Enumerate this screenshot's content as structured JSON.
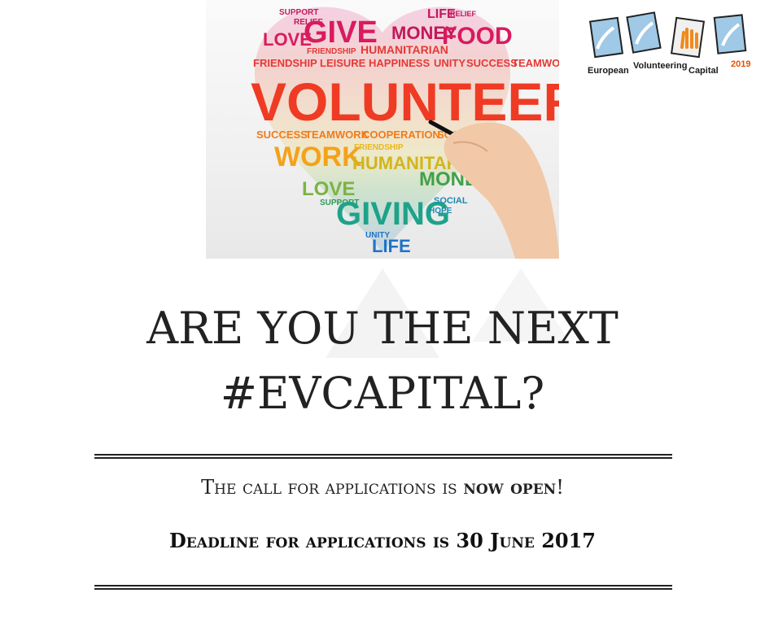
{
  "photo": {
    "words": [
      "SUPPORT",
      "RELIEF",
      "LIFE",
      "RELIEF",
      "LOVE",
      "GIVE",
      "MONEY",
      "FOOD",
      "FRIENDSHIP",
      "HUMANITARIAN",
      "FRIENDSHIP",
      "LEISURE",
      "HAPPINESS",
      "UNITY",
      "SUCCESS",
      "TEAMWORK",
      "VOLUNTEER",
      "SUCCESS",
      "TEAMWORK",
      "COOPERATION",
      "SOCIAL",
      "WORK",
      "FRIENDSHIP",
      "HUMANITARIAN",
      "LOVE",
      "MONEY",
      "SUPPORT",
      "GIVING",
      "SOCIAL",
      "UNITY",
      "LIFE",
      "HOPE"
    ]
  },
  "logo": {
    "word1": "European",
    "word2": "Volunteering",
    "word3": "Capital",
    "year": "2019"
  },
  "headline": {
    "line1": "ARE YOU THE NEXT",
    "line2": "#EVCAPITAL?"
  },
  "call": {
    "prefix": "The call for applications is ",
    "bold": "now open",
    "suffix": "!"
  },
  "deadline": "Deadline for applications is 30 June 2017"
}
